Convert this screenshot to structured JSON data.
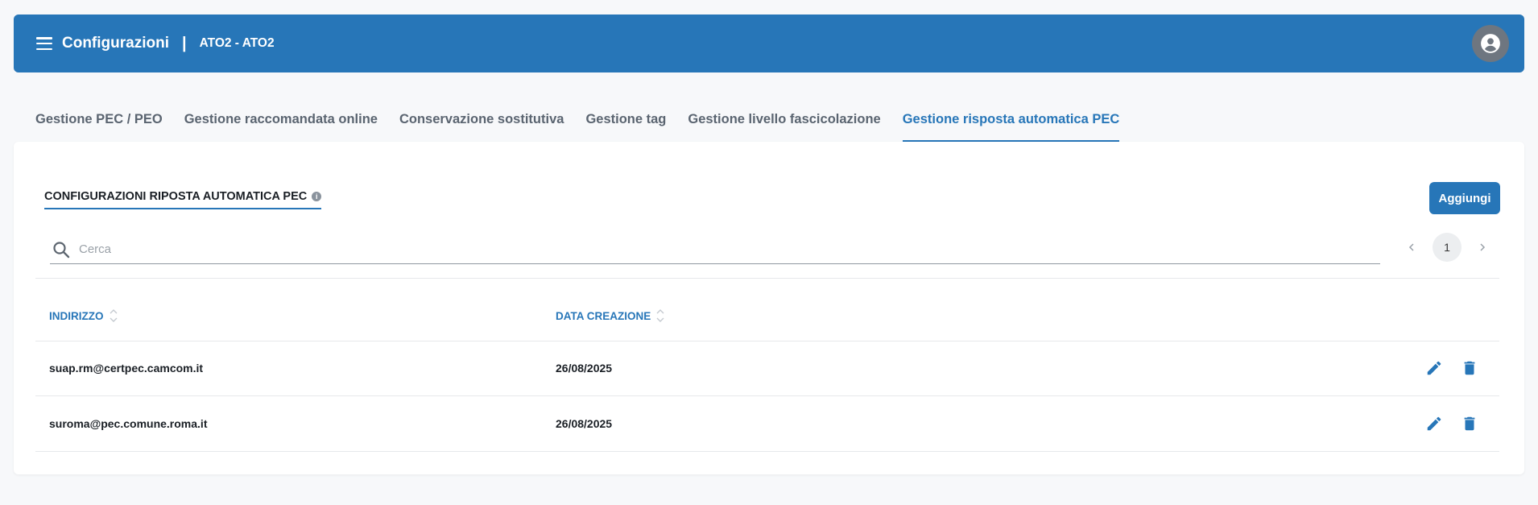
{
  "header": {
    "title": "Configurazioni",
    "separator": "|",
    "organization": "ATO2 - ATO2"
  },
  "tabs": [
    {
      "label": "Gestione PEC / PEO"
    },
    {
      "label": "Gestione raccomandata online"
    },
    {
      "label": "Conservazione sostitutiva"
    },
    {
      "label": "Gestione tag"
    },
    {
      "label": "Gestione livello fascicolazione"
    },
    {
      "label": "Gestione risposta automatica PEC",
      "active": true
    }
  ],
  "section": {
    "title": "CONFIGURAZIONI RIPOSTA AUTOMATICA PEC",
    "info_icon": "i",
    "add_label": "Aggiungi"
  },
  "search": {
    "placeholder": "Cerca",
    "value": ""
  },
  "pagination": {
    "current_page": "1"
  },
  "table": {
    "columns": [
      "INDIRIZZO",
      "DATA CREAZIONE"
    ],
    "rows": [
      {
        "address": "suap.rm@certpec.camcom.it",
        "created": "26/08/2025"
      },
      {
        "address": "suroma@pec.comune.roma.it",
        "created": "26/08/2025"
      }
    ]
  },
  "colors": {
    "primary": "#2776b8",
    "background": "#f7f8fa",
    "avatar": "#6e7680"
  },
  "icons": [
    "menu-icon",
    "avatar-icon",
    "info-icon",
    "search-icon",
    "chevron-left-icon",
    "chevron-right-icon",
    "sort-icon",
    "edit-icon",
    "delete-icon"
  ]
}
